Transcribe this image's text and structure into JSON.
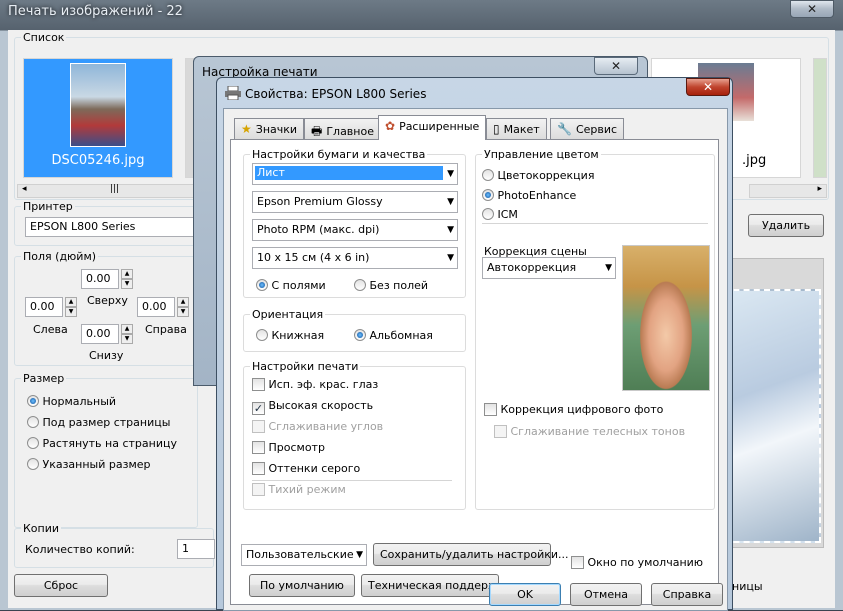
{
  "main": {
    "title": "Печать изображений - 22",
    "list_label": "Список",
    "thumb_selected_label": "DSC05246.jpg",
    "thumb_right_label": ".jpg",
    "printer_label": "Принтер",
    "printer_name": "EPSON L800 Series",
    "delete_button": "Удалить",
    "margins_label": "Поля (дюйм)",
    "margin_top_value": "0.00",
    "margin_top_label": "Сверху",
    "margin_left_value": "0.00",
    "margin_left_label": "Слева",
    "margin_right_value": "0.00",
    "margin_right_label": "Справа",
    "margin_bottom_value": "0.00",
    "margin_bottom_label": "Снизу",
    "size_label": "Размер",
    "size_options": [
      "Нормальный",
      "Под размер страницы",
      "Растянуть на страницу",
      "Указанный размер"
    ],
    "copies_label": "Копии",
    "copies_count_label": "Количество копий:",
    "copies_value": "1",
    "reset_button": "Сброс",
    "partial_text_bottom": "ницы"
  },
  "print_setup": {
    "title": "Настройка печати"
  },
  "props": {
    "title": "Свойства: EPSON L800 Series",
    "tabs": [
      "Значки",
      "Главное",
      "Расширенные",
      "Макет",
      "Сервис"
    ],
    "paper": {
      "label": "Настройки бумаги и качества",
      "source": "Лист",
      "type": "Epson Premium Glossy",
      "quality": "Photo RPM (макс. dpi)",
      "size": "10 x 15 см (4 x 6 in)",
      "with_margins": "С полями",
      "borderless": "Без полей"
    },
    "orientation": {
      "label": "Ориентация",
      "portrait": "Книжная",
      "landscape": "Альбомная"
    },
    "print_settings": {
      "label": "Настройки печати",
      "items": [
        {
          "text": "Исп. эф. крас. глаз",
          "checked": false,
          "disabled": false
        },
        {
          "text": "Высокая скорость",
          "checked": true,
          "disabled": false
        },
        {
          "text": "Сглаживание углов",
          "checked": false,
          "disabled": true
        },
        {
          "text": "Просмотр",
          "checked": false,
          "disabled": false
        },
        {
          "text": "Оттенки серого",
          "checked": false,
          "disabled": false
        },
        {
          "text": "Тихий режим",
          "checked": false,
          "disabled": true
        }
      ]
    },
    "color": {
      "label": "Управление цветом",
      "options": [
        "Цветокоррекция",
        "PhotoEnhance",
        "ICM"
      ],
      "scene_label": "Коррекция сцены",
      "scene_value": "Автокоррекция",
      "digital_fix": "Коррекция цифрового фото",
      "skin_smooth": "Сглаживание телесных тонов"
    },
    "preset_value": "Пользовательские",
    "save_delete_button": "Сохранить/удалить настройки...",
    "default_window": "Окно по умолчанию",
    "defaults_button": "По умолчанию",
    "support_button": "Техническая поддержка",
    "ok_button": "OK",
    "cancel_button": "Отмена",
    "help_button": "Справка"
  }
}
